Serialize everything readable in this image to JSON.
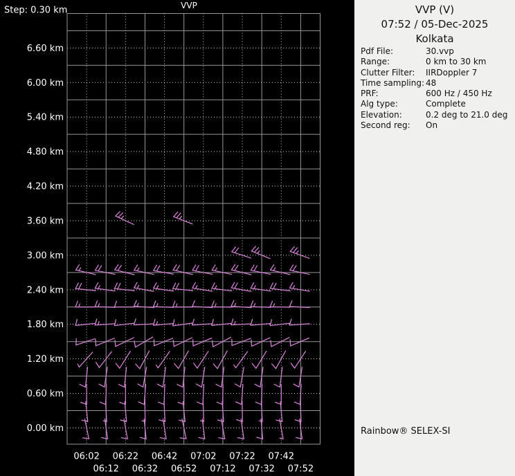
{
  "colors": {
    "background": "#000000",
    "panel_background": "#f0f0ee",
    "grid_line": "#96969a",
    "grid_dotted": "#d8d8d8",
    "axis_text": "#ffffff",
    "barb": "#d583d5",
    "panel_text": "#111111"
  },
  "panel": {
    "title": "VVP (V)",
    "datetime": "07:52 / 05-Dec-2025",
    "site": "Kolkata",
    "params": [
      {
        "label": "Pdf File:",
        "value": "30.vvp"
      },
      {
        "label": "Range:",
        "value": "0 km to 30 km"
      },
      {
        "label": "Clutter Filter:",
        "value": "IIRDoppler 7"
      },
      {
        "label": "Time sampling:",
        "value": "48"
      },
      {
        "label": "PRF:",
        "value": "600 Hz / 450 Hz"
      },
      {
        "label": "Alg type:",
        "value": "Complete"
      },
      {
        "label": "Elevation:",
        "value": "0.2 deg to 21.0 deg"
      },
      {
        "label": "Second reg:",
        "value": "On"
      }
    ],
    "footer": "Rainbow® SELEX-SI"
  },
  "chart_data": {
    "type": "wind-barb-profile",
    "title": "VVP",
    "step_label": "Step: 0.30 km",
    "time_start": "05:52",
    "time_end": "08:02",
    "time_minor_step_min": 10,
    "x_labels_row1": [
      "06:02",
      "06:22",
      "06:42",
      "07:02",
      "07:22",
      "07:42"
    ],
    "x_labels_row2": [
      "06:12",
      "06:32",
      "06:52",
      "07:12",
      "07:32",
      "07:52"
    ],
    "y_labels": [
      "0.00 km",
      "0.60 km",
      "1.20 km",
      "1.80 km",
      "2.40 km",
      "3.00 km",
      "3.60 km",
      "4.20 km",
      "4.80 km",
      "5.40 km",
      "6.00 km",
      "6.60 km"
    ],
    "y_label_step_km": 0.6,
    "height_min_km": -0.3,
    "height_max_km": 7.2,
    "height_step_km": 0.3,
    "barb_times": [
      "06:02",
      "06:12",
      "06:22",
      "06:32",
      "06:42",
      "06:52",
      "07:02",
      "07:12",
      "07:22",
      "07:32",
      "07:42",
      "07:52"
    ],
    "barb_rows": [
      {
        "h": 0.0,
        "times": "all",
        "dirs": [
          168,
          172,
          170,
          174,
          171,
          168,
          173,
          170,
          172,
          175,
          170,
          173
        ],
        "spds": [
          10,
          10,
          10,
          10,
          10,
          10,
          10,
          10,
          10,
          10,
          5,
          10
        ]
      },
      {
        "h": 0.3,
        "times": "all",
        "dirs": [
          174,
          177,
          175,
          179,
          177,
          174,
          178,
          176,
          179,
          177,
          175,
          178
        ],
        "spds": [
          10,
          5,
          10,
          5,
          10,
          10,
          5,
          10,
          10,
          5,
          10,
          10
        ]
      },
      {
        "h": 0.6,
        "times": "all",
        "dirs": [
          180,
          182,
          180,
          184,
          182,
          180,
          183,
          181,
          184,
          182,
          180,
          183
        ],
        "spds": [
          10,
          10,
          10,
          10,
          10,
          10,
          10,
          10,
          10,
          10,
          10,
          10
        ]
      },
      {
        "h": 0.9,
        "times": "all",
        "dirs": [
          186,
          188,
          186,
          190,
          188,
          186,
          189,
          187,
          190,
          188,
          187,
          189
        ],
        "spds": [
          10,
          10,
          10,
          10,
          10,
          10,
          10,
          10,
          10,
          10,
          10,
          10
        ]
      },
      {
        "h": 1.2,
        "times": "all",
        "dirs": [
          222,
          218,
          212,
          208,
          215,
          210,
          213,
          209,
          216,
          211,
          209,
          213
        ],
        "spds": [
          5,
          10,
          10,
          10,
          5,
          10,
          10,
          10,
          5,
          10,
          10,
          10
        ]
      },
      {
        "h": 1.5,
        "times": "all",
        "dirs": [
          252,
          248,
          244,
          240,
          248,
          244,
          247,
          242,
          249,
          245,
          243,
          247
        ],
        "spds": [
          10,
          10,
          10,
          10,
          10,
          10,
          10,
          10,
          10,
          10,
          10,
          10
        ]
      },
      {
        "h": 1.8,
        "times": "all",
        "dirs": [
          264,
          266,
          263,
          267,
          265,
          262,
          266,
          264,
          267,
          265,
          263,
          266
        ],
        "spds": [
          10,
          15,
          10,
          10,
          15,
          10,
          10,
          10,
          15,
          10,
          10,
          10
        ]
      },
      {
        "h": 2.1,
        "times": "all",
        "dirs": [
          270,
          272,
          270,
          274,
          272,
          270,
          273,
          271,
          274,
          272,
          271,
          273
        ],
        "spds": [
          15,
          15,
          10,
          15,
          15,
          15,
          10,
          15,
          15,
          15,
          15,
          10
        ]
      },
      {
        "h": 2.4,
        "times": "all",
        "dirs": [
          276,
          278,
          276,
          280,
          278,
          276,
          279,
          277,
          280,
          278,
          277,
          279
        ],
        "spds": [
          20,
          15,
          20,
          15,
          15,
          20,
          15,
          15,
          20,
          15,
          20,
          15
        ]
      },
      {
        "h": 2.7,
        "times": "all",
        "dirs": [
          283,
          281,
          284,
          282,
          280,
          283,
          281,
          282,
          284,
          281,
          283,
          282
        ],
        "spds": [
          15,
          20,
          20,
          15,
          20,
          20,
          20,
          15,
          20,
          20,
          15,
          20
        ]
      },
      {
        "h": 3.0,
        "times": [
          "07:22",
          "07:32",
          "07:52"
        ],
        "dirs": [
          288,
          292,
          290
        ],
        "spds": [
          20,
          25,
          25
        ]
      },
      {
        "h": 3.6,
        "times": [
          "06:22",
          "06:52"
        ],
        "dirs": [
          295,
          291
        ],
        "spds": [
          25,
          25
        ]
      }
    ]
  }
}
